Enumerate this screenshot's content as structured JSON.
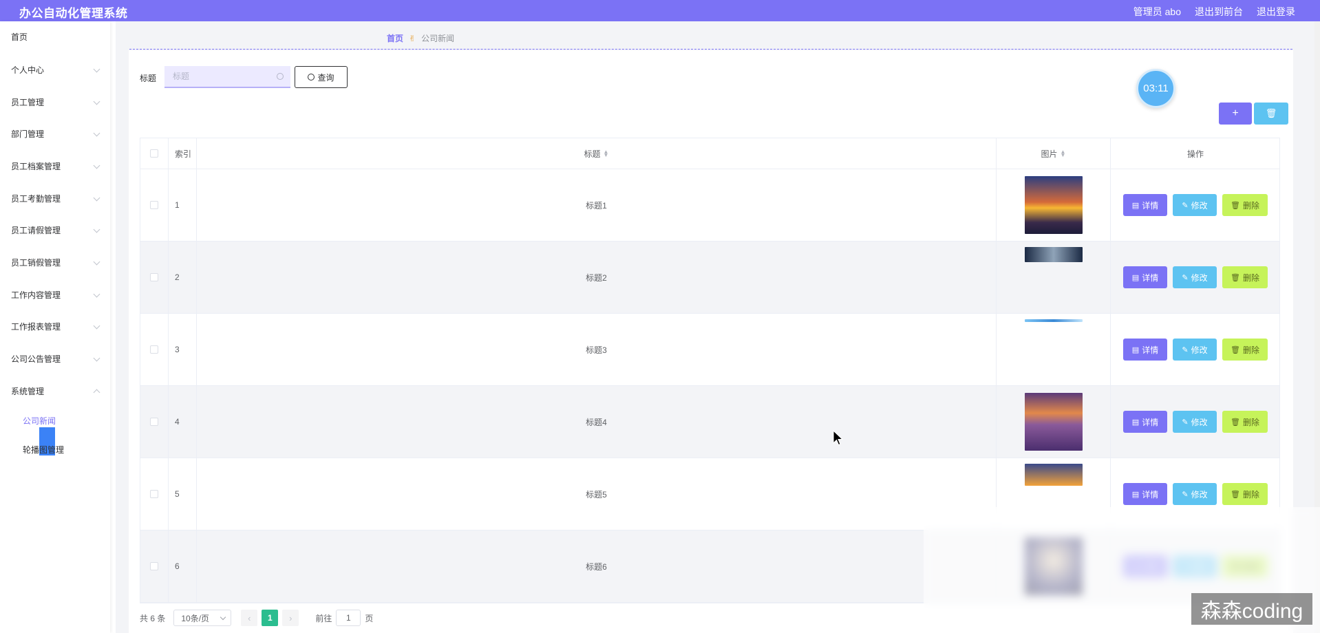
{
  "header": {
    "title": "办公自动化管理系统",
    "user": "管理员 abo",
    "to_front": "退出到前台",
    "logout": "退出登录"
  },
  "sidebar": {
    "items": [
      {
        "label": "首页",
        "has_children": false
      },
      {
        "label": "个人中心",
        "has_children": true
      },
      {
        "label": "员工管理",
        "has_children": true
      },
      {
        "label": "部门管理",
        "has_children": true
      },
      {
        "label": "员工档案管理",
        "has_children": true
      },
      {
        "label": "员工考勤管理",
        "has_children": true
      },
      {
        "label": "员工请假管理",
        "has_children": true
      },
      {
        "label": "员工销假管理",
        "has_children": true
      },
      {
        "label": "工作内容管理",
        "has_children": true
      },
      {
        "label": "工作报表管理",
        "has_children": true
      },
      {
        "label": "公司公告管理",
        "has_children": true
      },
      {
        "label": "系统管理",
        "has_children": true,
        "expanded": true
      }
    ],
    "submenu": [
      {
        "label": "公司新闻",
        "active": true
      },
      {
        "label": "轮播图管理",
        "active": false
      }
    ]
  },
  "breadcrumb": {
    "home": "首页",
    "current": "公司新闻"
  },
  "search": {
    "label": "标题",
    "placeholder": "标题",
    "button": "查询"
  },
  "timer": "03:11",
  "toolbar": {
    "add_icon": "plus-icon",
    "delete_icon": "trash-icon"
  },
  "table": {
    "columns": {
      "index": "索引",
      "title": "标题",
      "image": "图片",
      "actions": "操作"
    },
    "rows": [
      {
        "index": "1",
        "title": "标题1"
      },
      {
        "index": "2",
        "title": "标题2"
      },
      {
        "index": "3",
        "title": "标题3"
      },
      {
        "index": "4",
        "title": "标题4"
      },
      {
        "index": "5",
        "title": "标题5"
      },
      {
        "index": "6",
        "title": "标题6"
      }
    ],
    "actions": {
      "detail": "详情",
      "edit": "修改",
      "delete": "删除"
    }
  },
  "pagination": {
    "total": "共 6 条",
    "page_size": "10条/页",
    "current_page": "1",
    "goto_label": "前往",
    "goto_value": "1",
    "page_suffix": "页"
  },
  "watermark": "森森coding",
  "colors": {
    "primary": "#7b72f5",
    "info": "#5dc3f1",
    "lime": "#c6f35a",
    "page_active": "#2bbd8f"
  }
}
